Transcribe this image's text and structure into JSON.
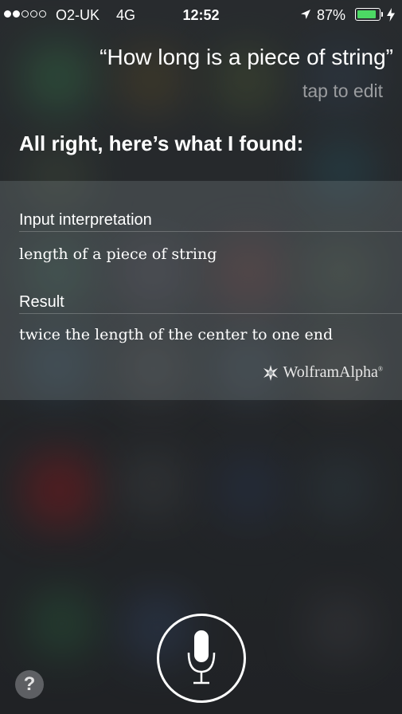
{
  "status_bar": {
    "carrier": "O2-UK",
    "network": "4G",
    "time": "12:52",
    "battery_percent": "87%",
    "battery_level": 0.87,
    "signal_bars_filled": 2,
    "signal_bars_total": 5
  },
  "siri": {
    "query": "“How long is a piece of string”",
    "tap_to_edit": "tap to edit",
    "response_title": "All right, here’s what I found:"
  },
  "result_card": {
    "input_label": "Input interpretation",
    "input_value": "length of a piece of string",
    "result_label": "Result",
    "result_value": "twice the length of the center to one end",
    "source_name": "WolframAlpha",
    "source_mark": "®"
  },
  "icons": {
    "location": "location-arrow-icon",
    "charging": "charging-bolt-icon",
    "microphone": "microphone-icon",
    "help": "question-mark-icon",
    "wolfram": "wolfram-spikey-icon"
  },
  "help_glyph": "?",
  "colors": {
    "battery": "#4cd964",
    "secondary_text": "#9a9c9f"
  }
}
